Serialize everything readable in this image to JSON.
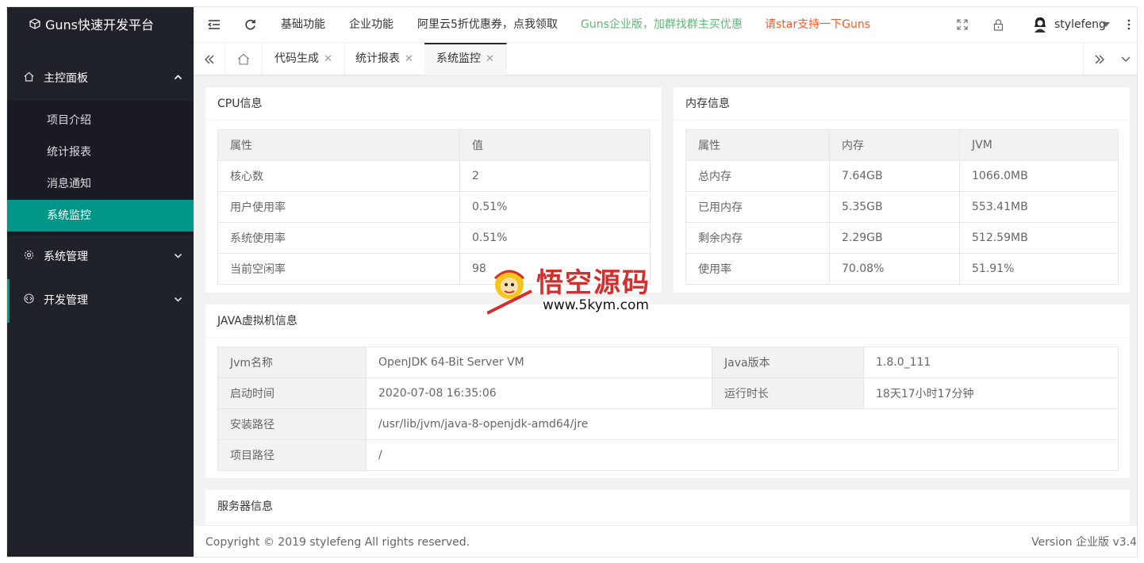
{
  "sidebar": {
    "logo": "Guns快速开发平台",
    "groups": [
      {
        "label": "主控面板",
        "items": [
          "项目介绍",
          "统计报表",
          "消息通知",
          "系统监控"
        ]
      },
      {
        "label": "系统管理"
      },
      {
        "label": "开发管理"
      }
    ]
  },
  "topbar": {
    "links": [
      "基础功能",
      "企业功能",
      "阿里云5折优惠券，点我领取",
      "Guns企业版，加群找群主买优惠",
      "请star支持一下Guns"
    ],
    "username": "stylefeng"
  },
  "tabs": [
    "代码生成",
    "统计报表",
    "系统监控"
  ],
  "cpu": {
    "title": "CPU信息",
    "headers": [
      "属性",
      "值"
    ],
    "rows": [
      [
        "核心数",
        "2"
      ],
      [
        "用户使用率",
        "0.51%"
      ],
      [
        "系统使用率",
        "0.51%"
      ],
      [
        "当前空闲率",
        "98"
      ]
    ]
  },
  "mem": {
    "title": "内存信息",
    "headers": [
      "属性",
      "内存",
      "JVM"
    ],
    "rows": [
      [
        "总内存",
        "7.64GB",
        "1066.0MB"
      ],
      [
        "已用内存",
        "5.35GB",
        "553.41MB"
      ],
      [
        "剩余内存",
        "2.29GB",
        "512.59MB"
      ],
      [
        "使用率",
        "70.08%",
        "51.91%"
      ]
    ]
  },
  "jvm": {
    "title": "JAVA虚拟机信息",
    "name_label": "Jvm名称",
    "name": "OpenJDK 64-Bit Server VM",
    "version_label": "Java版本",
    "version": "1.8.0_111",
    "start_label": "启动时间",
    "start": "2020-07-08 16:35:06",
    "run_label": "运行时长",
    "run": "18天17小时17分钟",
    "home_label": "安装路径",
    "home": "/usr/lib/jvm/java-8-openjdk-amd64/jre",
    "project_label": "项目路径",
    "project": "/"
  },
  "server": {
    "title": "服务器信息"
  },
  "footer": {
    "copyright": "Copyright © 2019 stylefeng All rights reserved.",
    "version": "Version 企业版 v3.4"
  },
  "watermark": {
    "text": "悟空源码",
    "url": "www.5kym.com"
  },
  "colors": {
    "accent": "#009688",
    "green_link": "#5fb878",
    "orange_link": "#ff5722",
    "sidebar": "#20222a"
  }
}
